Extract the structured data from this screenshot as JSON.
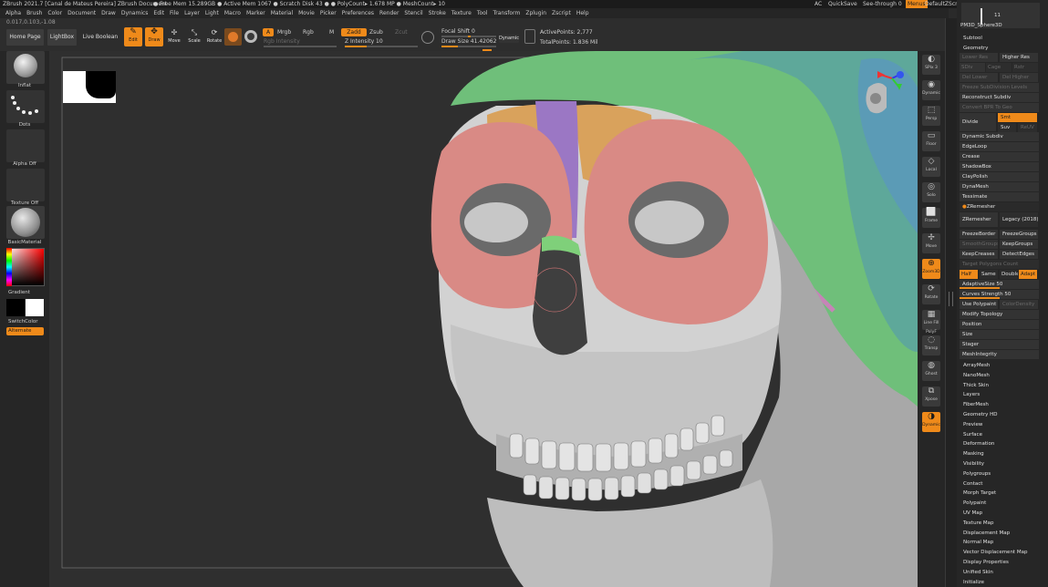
{
  "titlebar": {
    "app_title": "ZBrush 2021.7 [Canal de Mateus Pereira]   ZBrush Document",
    "stats": "● Free Mem 15.289GB ● Active Mem 1067 ● Scratch Disk 43 ● ● PolyCount▸ 1.678 MP ● MeshCount▸ 10",
    "ac": "AC",
    "quicksave": "QuickSave",
    "see_through": "See-through  0",
    "menus_label": "Menus",
    "script": "DefaultZScript"
  },
  "menubar": [
    "Alpha",
    "Brush",
    "Color",
    "Document",
    "Draw",
    "Dynamics",
    "Edit",
    "File",
    "Layer",
    "Light",
    "Macro",
    "Marker",
    "Material",
    "Movie",
    "Picker",
    "Preferences",
    "Render",
    "Stencil",
    "Stroke",
    "Texture",
    "Tool",
    "Transform",
    "Zplugin",
    "Zscript",
    "Help"
  ],
  "coords": "0.017,0.103,-1.08",
  "topbar": {
    "home_page": "Home Page",
    "lightbox": "LightBox",
    "live_boolean": "Live Boolean",
    "edit": "Edit",
    "draw": "Draw",
    "move": "Move",
    "scale": "Scale",
    "rotate": "Rotate",
    "a_label": "A",
    "mrgb": "Mrgb",
    "rgb": "Rgb",
    "m": "M",
    "zadd": "Zadd",
    "zsub": "Zsub",
    "zcut": "Zcut",
    "rgb_intensity": "Rgb Intensity",
    "z_intensity": "Z Intensity 10",
    "focal_shift": "Focal Shift 0",
    "draw_size": "Draw Size 41.42062",
    "dynamic": "Dynamic",
    "active_points": "ActivePoints: 2,777",
    "total_points": "TotalPoints: 1.836 Mil"
  },
  "leftshelf": {
    "brush": "Inflat",
    "stroke": "Dots",
    "alpha": "Alpha Off",
    "texture": "Texture Off",
    "material": "BasicMaterial",
    "gradient": "Gradient",
    "switch_color": "SwitchColor",
    "alternate": "Alternate"
  },
  "rightshelf": [
    "SPix 3",
    "Dynamic",
    "Persp",
    "Floor",
    "Local",
    "Solo",
    "Frame",
    "Move",
    "Zoom3D",
    "Rotate",
    "Line Fill PolyF",
    "Transp",
    "Ghost",
    "Xpose",
    "Dynamic"
  ],
  "panel": {
    "tool_name": "PM3D_Sphere3D",
    "tool_count": "11",
    "subtool": "Subtool",
    "geometry": "Geometry",
    "lower_res": "Lower Res",
    "higher_res": "Higher Res",
    "sdiv": "SDiv",
    "cage": "Cage",
    "rstr": "Rstr",
    "del_lower": "Del Lower",
    "del_higher": "Del Higher",
    "freeze_subdiv": "Freeze SubDivision Levels",
    "reconstruct_subdiv": "Reconstruct Subdiv",
    "convert_bpr": "Convert BPR To Geo",
    "divide": "Divide",
    "smt": "Smt",
    "suv": "Suv",
    "reuv": "ReUV",
    "dynamic_subdiv": "Dynamic Subdiv",
    "edgeloop": "EdgeLoop",
    "crease": "Crease",
    "shadowbox": "ShadowBox",
    "claypolish": "ClayPolish",
    "dynamesh": "DynaMesh",
    "tessimate": "Tessimate",
    "zremesher_header": "ZRemesher",
    "zremesher": "ZRemesher",
    "legacy": "Legacy (2018)",
    "freeze_border": "FreezeBorder",
    "freeze_groups": "FreezeGroups",
    "smooth_groups": "SmoothGroups",
    "keep_groups": "KeepGroups",
    "keep_creases": "KeepCreases",
    "detect_edges": "DetectEdges",
    "target_poly": "Target Polygons Count",
    "half": "Half",
    "same": "Same",
    "double": "Double",
    "adapt": "Adapt",
    "adaptive_size": "AdaptiveSize 50",
    "curves_strength": "Curves Strength 50",
    "use_polypaint": "Use Polypaint",
    "color_density": "ColorDensity",
    "modify_topology": "Modify Topology",
    "position": "Position",
    "size": "Size",
    "stager": "Stager",
    "meshintegrity": "MeshIntegrity",
    "sections": [
      "ArrayMesh",
      "NanoMesh",
      "Thick Skin",
      "Layers",
      "FiberMesh",
      "Geometry HD",
      "Preview",
      "Surface",
      "Deformation",
      "Masking",
      "Visibility",
      "Polygroups",
      "Contact",
      "Morph Target",
      "Polypaint",
      "UV Map",
      "Texture Map",
      "Displacement Map",
      "Normal Map",
      "Vector Displacement Map",
      "Display Properties",
      "Unified Skin",
      "Initialize"
    ]
  },
  "viewport": {
    "subject": "skull-model"
  },
  "colors": {
    "accent": "#ef8a1a",
    "skull": "#c9c9c9",
    "orbit": "#d98a85",
    "nasal": "#9b77c4",
    "brow": "#d9a25c",
    "cranium_green": "#6fbf7a",
    "cranium_teal": "#5ea89a",
    "polygroup_pink": "#d67ac2"
  }
}
